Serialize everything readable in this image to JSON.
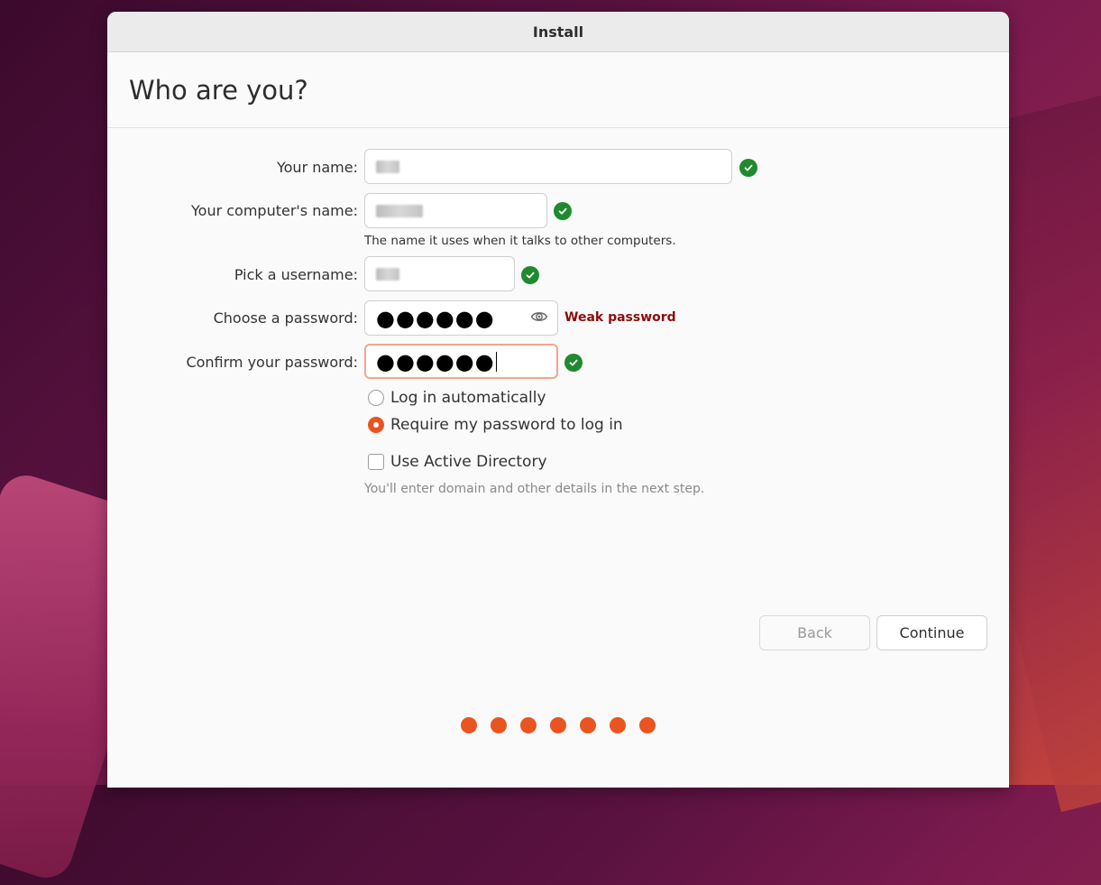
{
  "window": {
    "title": "Install"
  },
  "page": {
    "heading": "Who are you?"
  },
  "form": {
    "name_label": "Your name:",
    "computer_label": "Your computer's name:",
    "computer_hint": "The name it uses when it talks to other computers.",
    "username_label": "Pick a username:",
    "password_label": "Choose a password:",
    "password_value": "●●●●●●",
    "password_strength": "Weak password",
    "confirm_label": "Confirm your password:",
    "confirm_value": "●●●●●●"
  },
  "login_options": {
    "auto": "Log in automatically",
    "require": "Require my password to log in",
    "selected": "require"
  },
  "active_directory": {
    "label": "Use Active Directory",
    "checked": false,
    "hint": "You'll enter domain and other details in the next step."
  },
  "buttons": {
    "back": "Back",
    "continue": "Continue"
  },
  "progress": {
    "steps": 7
  },
  "colors": {
    "accent": "#e95420",
    "success": "#1f8a2e",
    "warning": "#8b0d0d"
  },
  "icons": {
    "valid": "check-circle-icon",
    "reveal": "eye-icon"
  }
}
